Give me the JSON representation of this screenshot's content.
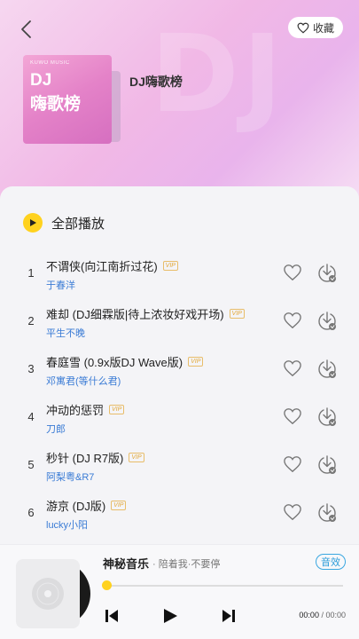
{
  "header": {
    "favorite_label": "收藏",
    "cover": {
      "brand": "KUWO MUSIC",
      "line1": "DJ",
      "line2": "嗨歌榜"
    },
    "title": "DJ嗨歌榜"
  },
  "list": {
    "play_all_label": "全部播放",
    "vip_label": "VIP",
    "songs": [
      {
        "index": "1",
        "title": "不谓侠(向江南折过花)",
        "artist": "于春洋"
      },
      {
        "index": "2",
        "title": "难却 (DJ细霖版|待上浓妆好戏开场)",
        "artist": "平生不晚"
      },
      {
        "index": "3",
        "title": "春庭雪 (0.9x版DJ Wave版)",
        "artist": "邓寓君(等什么君)"
      },
      {
        "index": "4",
        "title": "冲动的惩罚",
        "artist": "刀郎"
      },
      {
        "index": "5",
        "title": "秒针 (DJ R7版)",
        "artist": "阿梨粤&R7"
      },
      {
        "index": "6",
        "title": "游京 (DJ版)",
        "artist": "lucky小阳"
      }
    ]
  },
  "player": {
    "title": "神秘音乐",
    "artist": "· 陪着我·不要停",
    "effect_label": "音效",
    "current_time": "00:00",
    "separator": " / ",
    "total_time": "00:00",
    "progress": 0
  },
  "colors": {
    "accent": "#ffd21f",
    "artist_link": "#3a7bd5",
    "vip": "#e3a93b"
  }
}
